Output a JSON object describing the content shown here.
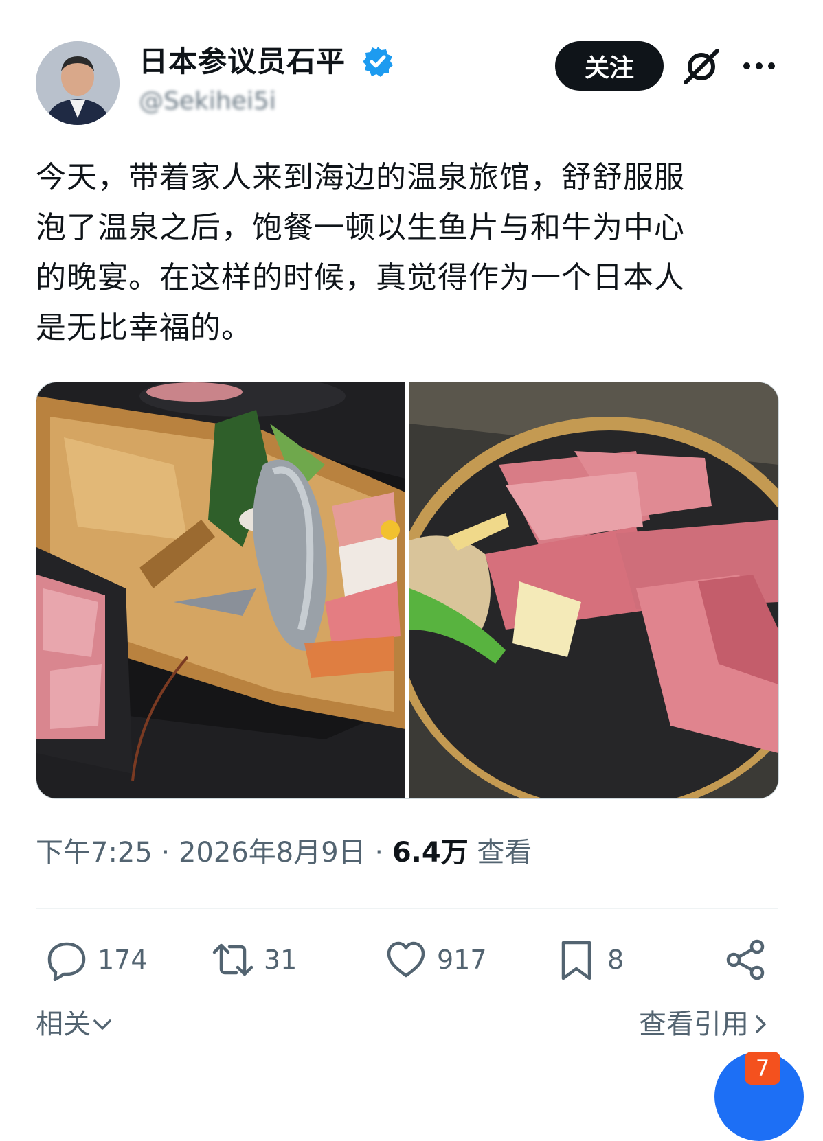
{
  "author": {
    "display_name": "日本参议员石平",
    "handle": "@Sekihei5i",
    "follow_label": "关注"
  },
  "tweet": {
    "text": "今天，带着家人来到海边的温泉旅馆，舒舒服服\n泡了温泉之后，饱餐一顿以生鱼片与和牛为中心\n的晚宴。在这样的时候，真觉得作为一个日本人\n是无比幸福的。"
  },
  "meta": {
    "time": "下午7:25",
    "date": "2026年8月9日",
    "views_count": "6.4万",
    "views_label": "查看"
  },
  "actions": {
    "replies": "174",
    "retweets": "31",
    "likes": "917",
    "bookmarks": "8"
  },
  "footer": {
    "related_label": "相关",
    "view_quotes_label": "查看引用"
  },
  "notification_badge": "7",
  "icons": {
    "verified": "verified-badge-icon",
    "grok": "grok-icon",
    "more": "more-icon",
    "reply": "reply-icon",
    "retweet": "retweet-icon",
    "like": "heart-icon",
    "bookmark": "bookmark-icon",
    "share": "share-icon"
  },
  "colors": {
    "brand_blue": "#1d9bf0",
    "text_primary": "#0f1419",
    "text_secondary": "#536471",
    "badge": "#f4511e"
  }
}
